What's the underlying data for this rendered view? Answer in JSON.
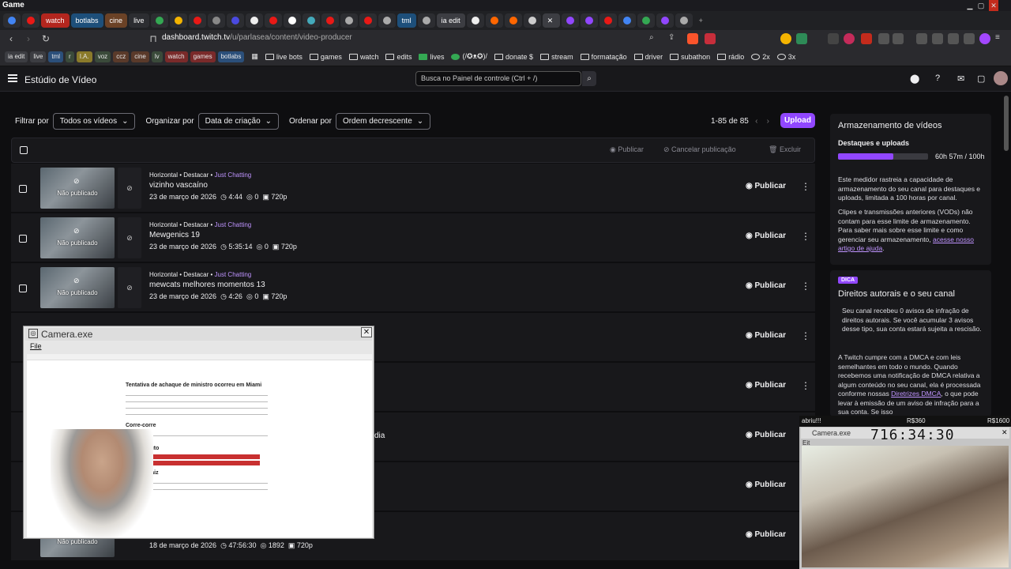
{
  "window": {
    "title": "Game"
  },
  "tabs": [
    {
      "label": "",
      "color": "#4285f4"
    },
    {
      "label": "",
      "color": "#e91916"
    },
    {
      "label": "watch",
      "color": "#e91916"
    },
    {
      "label": "botlabs",
      "color": "#0a84ff"
    },
    {
      "label": "cine",
      "color": "#8b5a2b"
    },
    {
      "label": "live",
      "color": "#666"
    },
    {
      "label": "tml",
      "color": "#0a84ff"
    },
    {
      "label": "ia edit",
      "color": "#555"
    }
  ],
  "address": {
    "host": "dashboard.twitch.tv",
    "path": "/u/parlasea/content/video-producer"
  },
  "bookmarks": {
    "chips": [
      "ia edit",
      "live",
      "tml",
      "r",
      "I.A.",
      "voz",
      "ccz",
      "cine",
      "lv",
      "watch",
      "games",
      "botlabs"
    ],
    "items": [
      "live bots",
      "games",
      "watch",
      "edits",
      "lives",
      "(/✪ᴥ✪)/",
      "donate $",
      "stream",
      "formatação",
      "driver",
      "subathon",
      "rádio",
      "2x",
      "3x"
    ]
  },
  "header": {
    "title": "Estúdio de Vídeo",
    "search_placeholder": "Busca no Painel de controle (Ctrl + /)"
  },
  "filters": {
    "filter_label": "Filtrar por",
    "filter_value": "Todos os vídeos",
    "organize_label": "Organizar por",
    "organize_value": "Data de criação",
    "order_label": "Ordenar por",
    "order_value": "Ordem decrescente"
  },
  "pagination": {
    "range": "1-85 de 85"
  },
  "upload_label": "Upload",
  "toolbar": {
    "publish": "Publicar",
    "unpublish": "Cancelar publicação",
    "delete": "Excluir"
  },
  "videos": [
    {
      "meta": "Horizontal • Destacar • ",
      "category": "Just Chatting",
      "title": "vizinho vascaíno",
      "date": "23 de março de 2026",
      "duration": "4:44",
      "views": "0",
      "res": "720p",
      "status": "Não publicado",
      "action": "Publicar"
    },
    {
      "meta": "Horizontal • Destacar • ",
      "category": "Just Chatting",
      "title": "Mewgenics 19",
      "date": "23 de março de 2026",
      "duration": "5:35:14",
      "views": "0",
      "res": "720p",
      "status": "Não publicado",
      "action": "Publicar"
    },
    {
      "meta": "Horizontal • Destacar • ",
      "category": "Just Chatting",
      "title": "mewcats melhores momentos 13",
      "date": "23 de março de 2026",
      "duration": "4:26",
      "views": "0",
      "res": "720p",
      "status": "Não publicado",
      "action": "Publicar"
    },
    {
      "action": "Publicar"
    },
    {
      "action": "Publicar"
    },
    {
      "title_fragment": "dia",
      "action": "Publicar"
    },
    {
      "action": "Publicar"
    },
    {
      "date": "18 de março de 2026",
      "duration": "47:56:30",
      "views": "1892",
      "res": "720p",
      "status": "Não publicado",
      "action": "Publicar"
    }
  ],
  "storage": {
    "title": "Armazenamento de vídeos",
    "label": "Destaques e uploads",
    "value": "60h 57m / 100h",
    "fraction": 0.61,
    "p1": "Este medidor rastreia a capacidade de armazenamento do seu canal para destaques e uploads, limitada a 100 horas por canal.",
    "p2": "Clipes e transmissões anteriores (VODs) não contam para esse limite de armazenamento. Para saber mais sobre esse limite e como gerenciar seu armazenamento, ",
    "p2_link": "acesse nosso artigo de ajuda",
    "p2_end": "."
  },
  "tip": {
    "badge": "DICA",
    "title": "Direitos autorais e o seu canal",
    "p1": "Seu canal recebeu 0 avisos de infração de direitos autorais. Se você acumular 3 avisos desse tipo, sua conta estará sujeita a rescisão.",
    "p2": "A Twitch cumpre com a DMCA e com leis semelhantes em todo o mundo. Quando recebemos uma notificação de DMCA relativa a algum conteúdo no seu canal, ela é processada conforme nossas ",
    "p2_link": "Diretrizes DMCA",
    "p2_end": ", o que pode levar à emissão de um aviso de infração para a sua conta. Se isso"
  },
  "camera": {
    "title": "Camera.exe",
    "menu": "File",
    "doc_heading": "Tentativa de achaque de ministro ocorreu em Miami",
    "doc_sections": [
      "Corre-corre",
      "Jogo é bruto",
      "Mal pela raiz"
    ]
  },
  "camera2": {
    "title": "Camera.exe",
    "menu": "Eit",
    "timer": "716:34:30",
    "top_left": "abriu!!!",
    "top_mid": "R$360",
    "top_right": "R$1600"
  }
}
